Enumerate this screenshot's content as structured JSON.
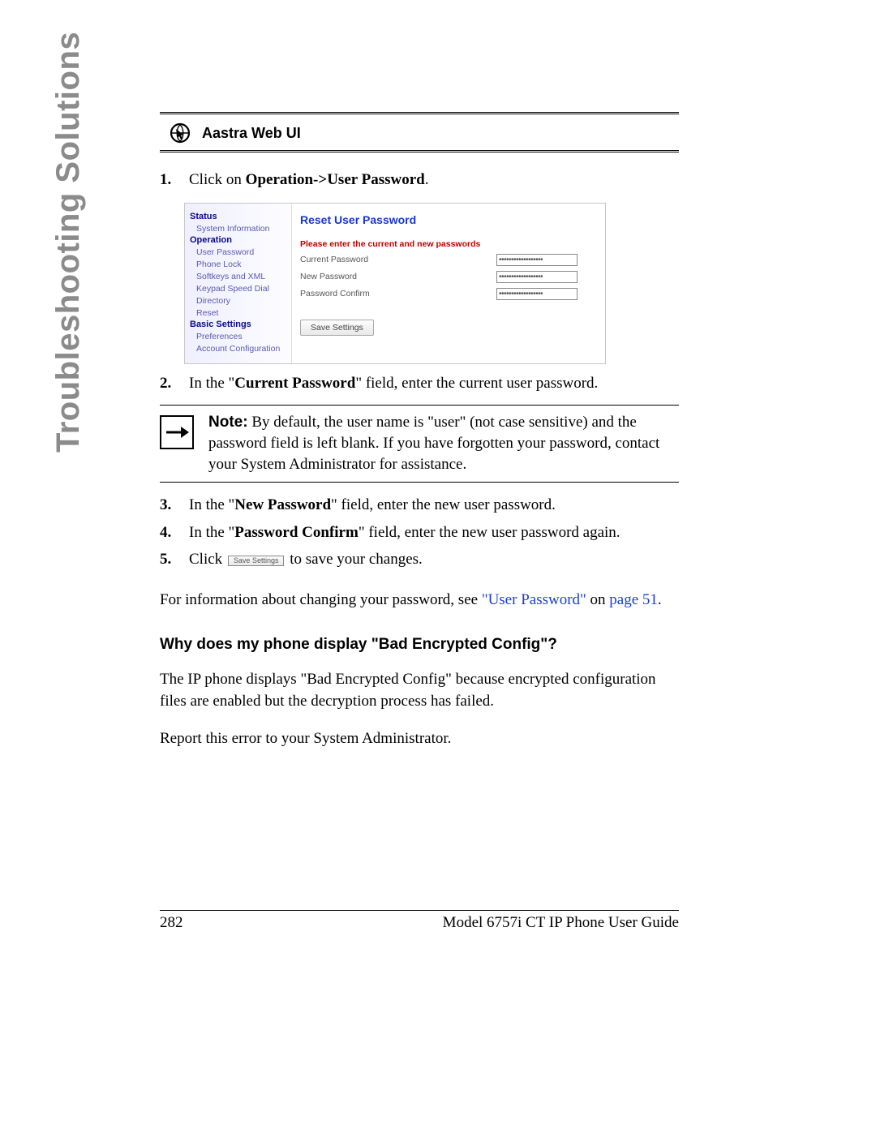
{
  "sidebar": {
    "title": "Troubleshooting Solutions"
  },
  "header": {
    "title": "Aastra Web UI"
  },
  "steps": {
    "s1_pre": "Click on ",
    "s1_bold": "Operation->User Password",
    "s1_post": ".",
    "s2a": "In the \"",
    "s2b": "Current Password",
    "s2c": "\" field, enter the current user password.",
    "s3a": "In the \"",
    "s3b": "New Password",
    "s3c": "\" field, enter the new user password.",
    "s4a": "In the \"",
    "s4b": "Password Confirm",
    "s4c": "\" field, enter the new user password again.",
    "s5a": "Click ",
    "s5btn": "Save Settings",
    "s5b": " to save your changes."
  },
  "screenshot": {
    "nav": {
      "status": "Status",
      "sysinfo": "System Information",
      "operation": "Operation",
      "items_op": [
        "User Password",
        "Phone Lock",
        "Softkeys and XML",
        "Keypad Speed Dial",
        "Directory",
        "Reset"
      ],
      "basic": "Basic Settings",
      "items_basic": [
        "Preferences",
        "Account Configuration"
      ]
    },
    "main": {
      "title": "Reset User Password",
      "instruction": "Please enter the current and new passwords",
      "rows": [
        {
          "label": "Current Password",
          "value": "••••••••••••••••••"
        },
        {
          "label": "New Password",
          "value": "••••••••••••••••••"
        },
        {
          "label": "Password Confirm",
          "value": "••••••••••••••••••"
        }
      ],
      "save": "Save Settings"
    }
  },
  "note": {
    "label": "Note:",
    "text": " By default, the user name is \"user\" (not case sensitive) and the password field is left blank. If you have forgotten your password, contact your System Administrator for assistance."
  },
  "ref": {
    "pre": "For information about changing your password, see ",
    "link1": "\"User Password\"",
    "mid": " on ",
    "link2": "page 51",
    "post": "."
  },
  "faq": {
    "heading": "Why does my phone display \"Bad Encrypted Config\"?",
    "p1": "The IP phone displays \"Bad Encrypted Config\" because encrypted configuration files are enabled but the decryption process has failed.",
    "p2": "Report this error to your System Administrator."
  },
  "footer": {
    "page": "282",
    "doc": "Model 6757i CT IP Phone User Guide"
  }
}
